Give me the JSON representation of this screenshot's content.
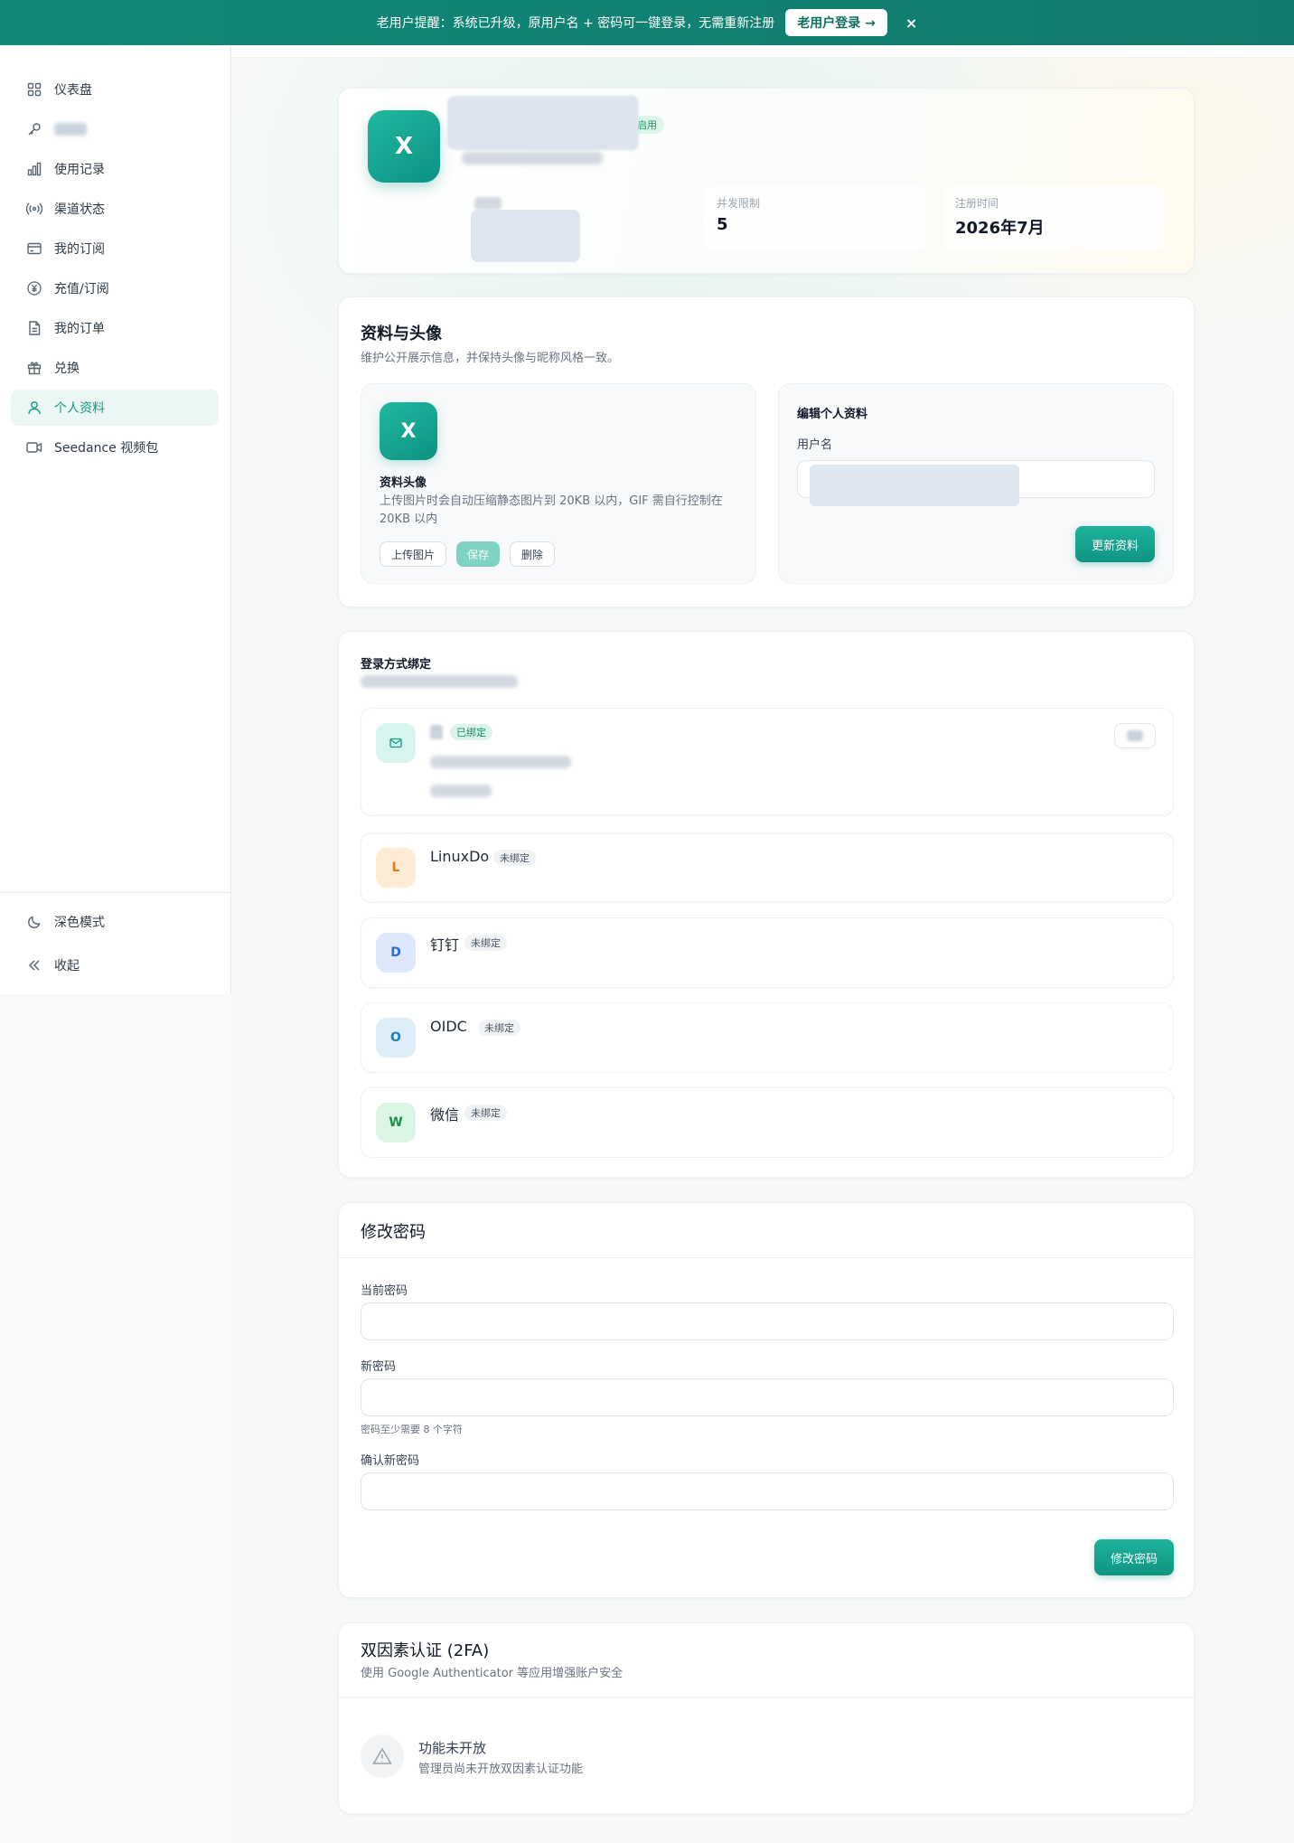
{
  "banner": {
    "text": "老用户提醒：系统已升级，原用户名 + 密码可一键登录，无需重新注册",
    "button": "老用户登录 →",
    "close": "×"
  },
  "sidebar": {
    "items": [
      {
        "label": "仪表盘",
        "icon": "dashboard-icon"
      },
      {
        "label": "",
        "icon": "key-icon",
        "redacted": true
      },
      {
        "label": "使用记录",
        "icon": "bar-chart-icon"
      },
      {
        "label": "渠道状态",
        "icon": "signal-icon"
      },
      {
        "label": "我的订阅",
        "icon": "card-icon"
      },
      {
        "label": "充值/订阅",
        "icon": "yen-icon"
      },
      {
        "label": "我的订单",
        "icon": "file-icon"
      },
      {
        "label": "兑换",
        "icon": "gift-icon"
      },
      {
        "label": "个人资料",
        "icon": "user-icon",
        "active": true
      },
      {
        "label": "Seedance 视频包",
        "icon": "video-icon"
      }
    ],
    "dark_mode": "深色模式",
    "collapse": "收起"
  },
  "header": {
    "avatar_letter": "X",
    "role_badge": "启用",
    "stats": [
      {
        "label": "并发限制",
        "value": "5"
      },
      {
        "label": "注册时间",
        "value": "2026年7月"
      }
    ]
  },
  "profile": {
    "title": "资料与头像",
    "subtitle": "维护公开展示信息，并保持头像与昵称风格一致。",
    "avatar_letter": "X",
    "avatar_title": "资料头像",
    "avatar_desc": "上传图片时会自动压缩静态图片到 20KB 以内，GIF 需自行控制在 20KB 以内",
    "btn_upload": "上传图片",
    "btn_save": "保存",
    "btn_delete": "删除",
    "edit_title": "编辑个人资料",
    "username_label": "用户名",
    "btn_update": "更新资料"
  },
  "bindings": {
    "title": "登录方式绑定",
    "email_status": "已绑定",
    "items": [
      {
        "letter": "L",
        "name": "LinuxDo",
        "status": "未绑定",
        "color": "#ea7a16",
        "bg": "#fdebd3"
      },
      {
        "letter": "D",
        "name": "钉钉",
        "status": "未绑定",
        "color": "#2f6bd6",
        "bg": "#dde9fb"
      },
      {
        "letter": "O",
        "name": "OIDC",
        "status": "未绑定",
        "color": "#1f7fb8",
        "bg": "#dcedf7"
      },
      {
        "letter": "W",
        "name": "微信",
        "status": "未绑定",
        "color": "#17924d",
        "bg": "#dcf4e4"
      }
    ]
  },
  "password": {
    "title": "修改密码",
    "current_label": "当前密码",
    "new_label": "新密码",
    "new_hint": "密码至少需要 8 个字符",
    "confirm_label": "确认新密码",
    "btn_change": "修改密码"
  },
  "tfa": {
    "title": "双因素认证 (2FA)",
    "subtitle": "使用 Google Authenticator 等应用增强账户安全",
    "status_title": "功能未开放",
    "status_desc": "管理员尚未开放双因素认证功能"
  },
  "colors": {
    "accent": "#109480",
    "accent_light": "#eaf7f4",
    "banner": "#0f8a76"
  }
}
